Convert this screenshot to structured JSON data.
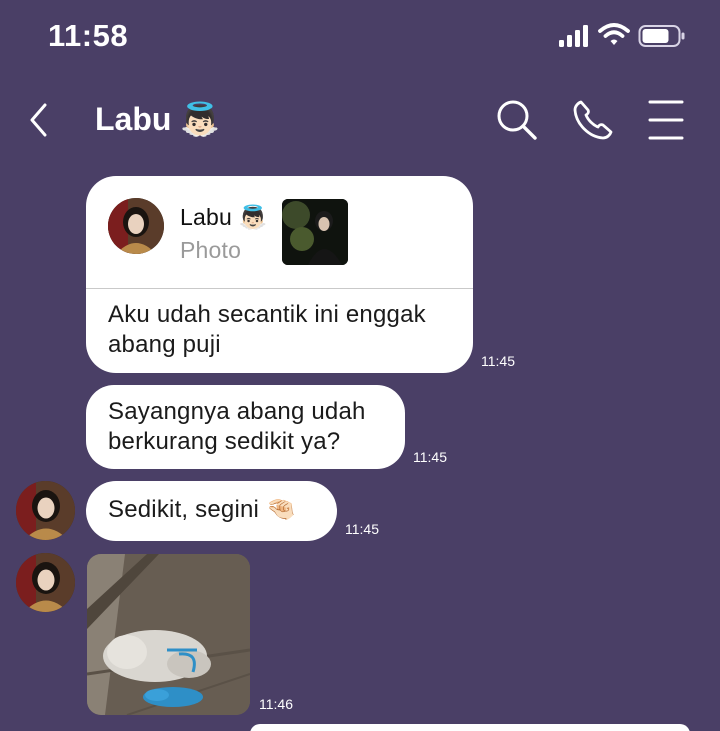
{
  "status_bar": {
    "time": "11:58",
    "icons": [
      "signal-icon",
      "wifi-icon",
      "battery-icon"
    ]
  },
  "header": {
    "back_icon": "chevron-left-icon",
    "contact_name": "Labu 👼🏻",
    "actions": [
      "search-icon",
      "phone-icon",
      "menu-icon"
    ]
  },
  "colors": {
    "background": "#4a3f66",
    "bubble": "#ffffff",
    "text": "#1b1b1b",
    "muted": "#9a9a9a"
  },
  "messages": [
    {
      "type": "reply",
      "quoted_name": "Labu 👼🏻",
      "quoted_label": "Photo",
      "text": "Aku udah secantik ini enggak abang puji",
      "time": "11:45"
    },
    {
      "type": "text",
      "text": "Sayangnya abang udah berkurang sedikit ya?",
      "time": "11:45"
    },
    {
      "type": "text",
      "text": "Sedikit, segini 🤏🏻",
      "time": "11:45"
    },
    {
      "type": "photo",
      "time": "11:46"
    }
  ]
}
